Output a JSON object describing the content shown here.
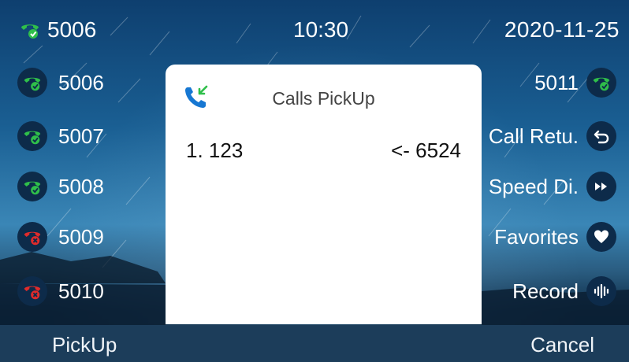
{
  "status": {
    "account": "5006",
    "time": "10:30",
    "date": "2020-11-25"
  },
  "line_keys": [
    {
      "label": "5006",
      "state": "registered",
      "icon": "phone-registered-icon"
    },
    {
      "label": "5007",
      "state": "registered",
      "icon": "phone-registered-icon"
    },
    {
      "label": "5008",
      "state": "registered",
      "icon": "phone-registered-icon"
    },
    {
      "label": "5009",
      "state": "unregistered",
      "icon": "phone-failed-icon"
    },
    {
      "label": "5010",
      "state": "unregistered",
      "icon": "phone-failed-icon"
    }
  ],
  "dss_keys": [
    {
      "label": "5011",
      "icon": "phone-registered-icon"
    },
    {
      "label": "Call Retu.",
      "icon": "return-arrow-icon"
    },
    {
      "label": "Speed Di.",
      "icon": "fast-forward-icon"
    },
    {
      "label": "Favorites",
      "icon": "heart-icon"
    },
    {
      "label": "Record",
      "icon": "voice-wave-icon"
    }
  ],
  "dialog": {
    "title": "Calls PickUp",
    "icon": "incoming-call-icon",
    "calls": [
      {
        "index": "1. 123",
        "from": "<- 6524"
      }
    ]
  },
  "softkeys": {
    "left": "PickUp",
    "right": "Cancel"
  },
  "colors": {
    "registered_green": "#2fbf4a",
    "failed_red": "#e02b2b",
    "dialog_accent_blue": "#1677d2",
    "softbar": "#1c3d5a"
  }
}
